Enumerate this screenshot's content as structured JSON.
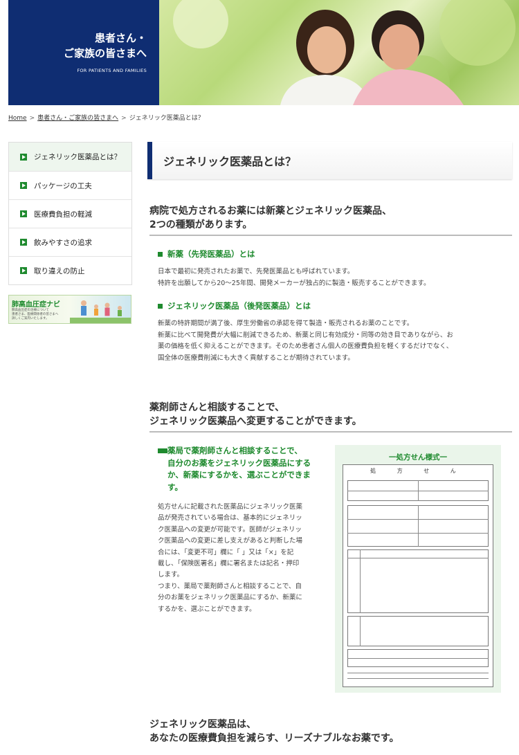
{
  "header": {
    "title_line1": "患者さん・",
    "title_line2": "ご家族の皆さまへ",
    "subtitle": "FOR PATIENTS AND FAMILIES"
  },
  "breadcrumb": {
    "home": "Home",
    "parent": "患者さん・ご家族の皆さまへ",
    "current": "ジェネリック医薬品とは？",
    "separator": ">"
  },
  "sidebar": {
    "items": [
      {
        "label": "ジェネリック医薬品とは？"
      },
      {
        "label": "パッケージの工夫"
      },
      {
        "label": "医療費負担の軽減"
      },
      {
        "label": "飲みやすさの追求"
      },
      {
        "label": "取り違えの防止"
      }
    ],
    "banner": {
      "title": "肺高血圧症ナビ",
      "line1": "肺高血圧症の治療について",
      "line2": "患者さま、医療関係者の皆さまへ",
      "line3": "詳しくご案内いたします。"
    }
  },
  "page": {
    "title": "ジェネリック医薬品とは？"
  },
  "section1": {
    "heading_line1": "病院で処方されるお薬には新薬とジェネリック医薬品、",
    "heading_line2": "2つの種類があります。",
    "sub1_heading": "新薬（先発医薬品）とは",
    "sub1_text_line1": "日本で最初に発売されたお薬で、先発医薬品とも呼ばれています。",
    "sub1_text_line2": "特許を出願してから20〜25年間、開発メーカーが独占的に製造・販売することができます。",
    "sub2_heading": "ジェネリック医薬品（後発医薬品）とは",
    "sub2_text_line1": "新薬の特許期間が満了後、厚生労働省の承認を得て製造・販売されるお薬のことです。",
    "sub2_text_line2": "新薬に比べて開発費が大幅に削減できるため、新薬と同じ有効成分・同等の効き目でありながら、お",
    "sub2_text_line3": "薬の価格を低く抑えることができます。そのため患者さん個人の医療費負担を軽くするだけでなく、",
    "sub2_text_line4": "国全体の医療費削減にも大きく貢献することが期待されています。"
  },
  "section2": {
    "heading_line1": "薬剤師さんと相談することで、",
    "heading_line2": "ジェネリック医薬品へ変更することができます。",
    "sub_heading_line1": "薬局で薬剤師さんと相談することで、",
    "sub_heading_line2": "自分のお薬をジェネリック医薬品にする",
    "sub_heading_line3": "か、新薬にするかを、選ぶことができま",
    "sub_heading_line4": "す。",
    "text_lines": [
      "処方せんに記載された医薬品にジェネリック医薬",
      "品が発売されている場合は、基本的にジェネリッ",
      "ク医薬品への変更が可能です。医師がジェネリッ",
      "ク医薬品への変更に差し支えがあると判断した場",
      "合には、「変更不可」欄に「 」又は「×」を記",
      "載し、「保険医署名」欄に署名または記名・押印",
      "します。",
      "つまり、薬局で薬剤師さんと相談することで、自",
      "分のお薬をジェネリック医薬品にするか、新薬に",
      "するかを、選ぶことができます。"
    ],
    "form_title": "一処方せん様式一",
    "form_heading": "処 方 せ ん"
  },
  "section3": {
    "heading_line1": "ジェネリック医薬品は、",
    "heading_line2": "あなたの医療費負担を減らす、リーズナブルなお薬です。"
  },
  "colors": {
    "navy": "#0f2d72",
    "green": "#1e8a2e"
  }
}
